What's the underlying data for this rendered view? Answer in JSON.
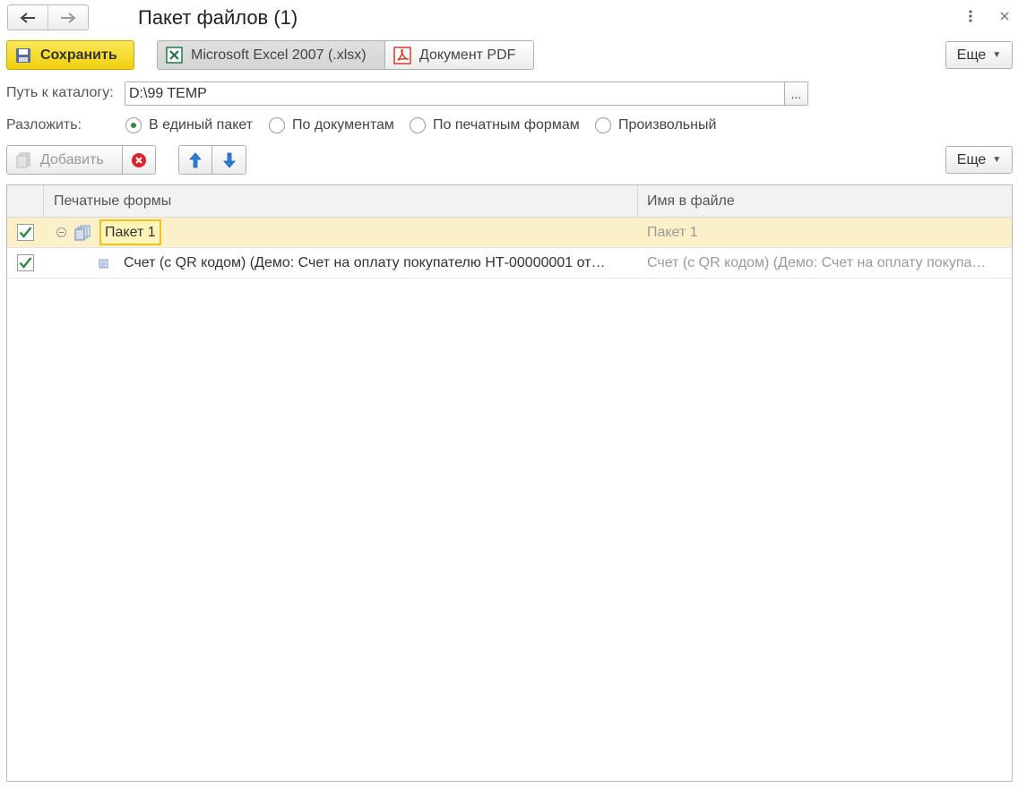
{
  "window": {
    "title": "Пакет файлов (1)",
    "back_icon": "arrow-left-icon",
    "forward_icon": "arrow-right-icon",
    "menu_icon": "kebab-menu-icon",
    "close_icon": "close-icon"
  },
  "toolbar": {
    "save_label": "Сохранить",
    "formats": [
      {
        "label": "Microsoft Excel 2007 (.xlsx)",
        "icon": "excel-icon",
        "pressed": true
      },
      {
        "label": "Документ PDF",
        "icon": "pdf-icon",
        "pressed": false
      }
    ],
    "more_label": "Еще"
  },
  "path": {
    "label": "Путь к каталогу:",
    "value": "D:\\99 TEMP",
    "select_button": "..."
  },
  "split": {
    "label": "Разложить:",
    "options": [
      {
        "label": "В единый пакет",
        "selected": true
      },
      {
        "label": "По документам",
        "selected": false
      },
      {
        "label": "По печатным формам",
        "selected": false
      },
      {
        "label": "Произвольный",
        "selected": false
      }
    ]
  },
  "list_toolbar": {
    "add_label": "Добавить",
    "more_label": "Еще"
  },
  "table": {
    "columns": [
      "Печатные формы",
      "Имя в файле"
    ],
    "rows": [
      {
        "checked": true,
        "type": "package",
        "form": "Пакет 1",
        "file_name": "Пакет 1"
      },
      {
        "checked": true,
        "type": "document",
        "form": "Счет (с QR кодом) (Демо: Счет на оплату покупателю НТ-00000001 от…",
        "file_name": "Счет (с QR кодом) (Демо: Счет на оплату покупа…"
      }
    ]
  },
  "colors": {
    "save_button": "#f1cf0e",
    "selected_row": "#fbf0c8",
    "check_mark": "#2b8a3e",
    "arrow_blue": "#2a7fd4",
    "delete_red": "#d9252a"
  }
}
